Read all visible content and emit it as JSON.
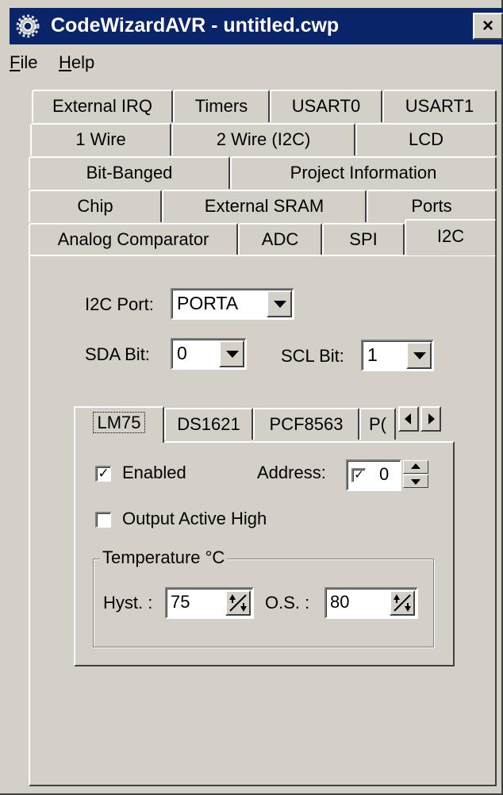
{
  "window": {
    "title": "CodeWizardAVR - untitled.cwp",
    "close_label": "×"
  },
  "menu": {
    "items": [
      {
        "label": "File"
      },
      {
        "label": "Help"
      }
    ]
  },
  "tabs": {
    "rows": [
      [
        "External IRQ",
        "Timers",
        "USART0",
        "USART1"
      ],
      [
        "1 Wire",
        "2 Wire (I2C)",
        "LCD"
      ],
      [
        "Bit-Banged",
        "Project Information"
      ],
      [
        "Chip",
        "External SRAM",
        "Ports"
      ],
      [
        "Analog Comparator",
        "ADC",
        "SPI",
        "I2C"
      ]
    ],
    "active": "I2C"
  },
  "i2c": {
    "port_label": "I2C Port:",
    "port_value": "PORTA",
    "sda_label": "SDA Bit:",
    "sda_value": "0",
    "scl_label": "SCL Bit:",
    "scl_value": "1"
  },
  "device_tabs": {
    "items": [
      "LM75",
      "DS1621",
      "PCF8563",
      "P("
    ],
    "active": "LM75"
  },
  "lm75": {
    "enabled_label": "Enabled",
    "enabled_checked": true,
    "address_label": "Address:",
    "address_check": true,
    "address_value": "0",
    "output_active_high_label": "Output Active High",
    "output_active_high_checked": false,
    "temperature": {
      "group_label": "Temperature °C",
      "hyst_label": "Hyst. :",
      "hyst_value": "75",
      "os_label": "O.S. :",
      "os_value": "80"
    }
  }
}
